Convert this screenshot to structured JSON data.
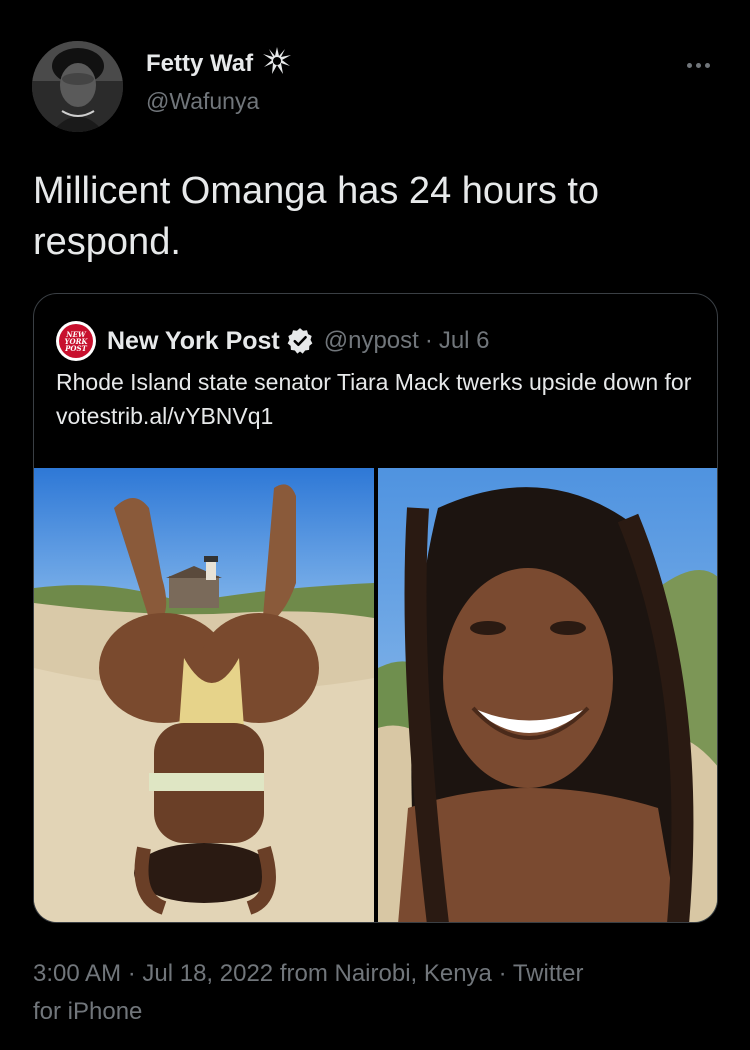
{
  "tweet": {
    "author": {
      "display_name": "Fetty Waf",
      "handle": "@Wafunya",
      "badge_icon": "spiky-badge-icon"
    },
    "more_icon": "more-horizontal-icon",
    "text": "Millicent Omanga has 24 hours to respond.",
    "quote": {
      "logo_text": "NEW\nYORK\nPOST",
      "display_name": "New York Post",
      "verified_icon": "verified-badge-icon",
      "handle": "@nypost",
      "separator": "·",
      "date": "Jul 6",
      "text": "Rhode Island state senator Tiara Mack twerks upside down for votestrib.al/vYBNVq1"
    },
    "timestamp": "3:00 AM · Jul 18, 2022 from Nairobi, Kenya · ",
    "source_line1": "Twitter",
    "source_line2": "for iPhone"
  },
  "colors": {
    "background": "#000000",
    "primary_text": "#e7e9ea",
    "secondary_text": "#71767b",
    "border": "#3a3f44",
    "nypost_red": "#c8102e"
  }
}
